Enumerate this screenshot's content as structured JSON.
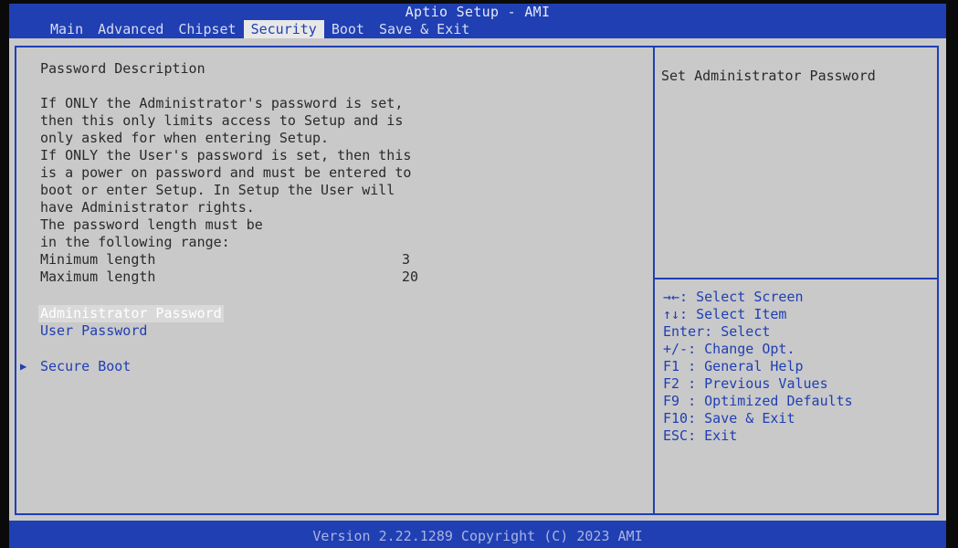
{
  "app_title": "Aptio Setup - AMI",
  "tabs": [
    "Main",
    "Advanced",
    "Chipset",
    "Security",
    "Boot",
    "Save & Exit"
  ],
  "active_tab": "Security",
  "description": {
    "heading": "Password Description",
    "lines": [
      "If ONLY the Administrator's password is set,",
      "then this only limits access to Setup and is",
      "only asked for when entering Setup.",
      "If ONLY the User's password is set, then this",
      "is a power on password and must be entered to",
      "boot or enter Setup. In Setup the User will",
      "have Administrator rights.",
      "The password length must be",
      "in the following range:"
    ],
    "min_label": "Minimum length",
    "min_value": "3",
    "max_label": "Maximum length",
    "max_value": "20"
  },
  "items": {
    "admin_password": "Administrator Password",
    "user_password": "User Password",
    "secure_boot": "Secure Boot"
  },
  "help": {
    "title": "Set Administrator Password"
  },
  "key_help": [
    "→←: Select Screen",
    "↑↓: Select Item",
    "Enter: Select",
    "+/-: Change Opt.",
    "F1 : General Help",
    "F2 : Previous Values",
    "F9 : Optimized Defaults",
    "F10: Save & Exit",
    "ESC: Exit"
  ],
  "footer": {
    "version": "Version 2.22.1289 Copyright (C) 2023 AMI"
  },
  "colors": {
    "bios_blue": "#1f3fb3",
    "panel_gray": "#c9c9c9",
    "selected_text": "#ffffff"
  }
}
